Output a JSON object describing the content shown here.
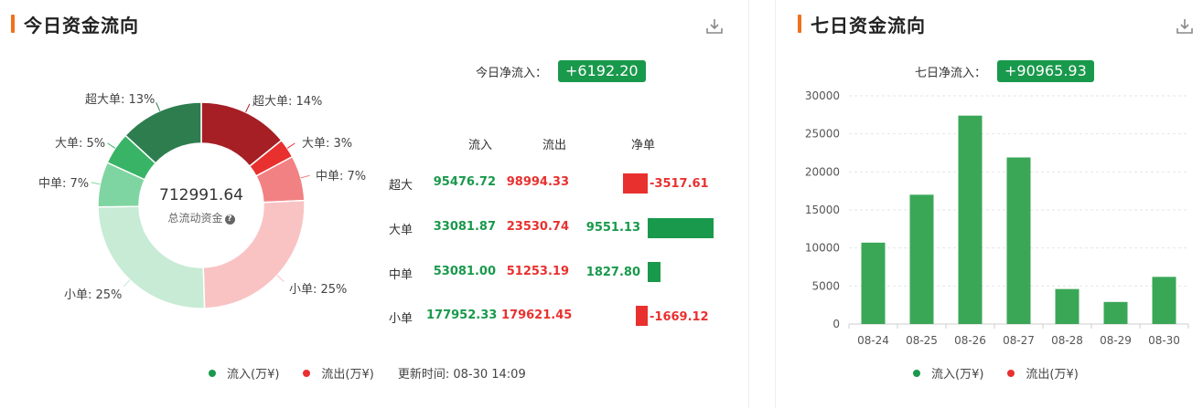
{
  "colors": {
    "accent": "#f0711c",
    "inflow": "#19994c",
    "outflow": "#e8312f",
    "bar_green": "#3aa757"
  },
  "today": {
    "title": "今日资金流向",
    "net_label": "今日净流入：",
    "net_value": "+6192.20",
    "total_value": "712991.64",
    "total_label": "总流动资金",
    "table": {
      "headers": {
        "in": "流入",
        "out": "流出",
        "net": "净单"
      },
      "rows": [
        {
          "label": "超大",
          "in": "95476.72",
          "out": "98994.33",
          "net": "-3517.61",
          "net_value": -3517.61
        },
        {
          "label": "大单",
          "in": "33081.87",
          "out": "23530.74",
          "net": "9551.13",
          "net_value": 9551.13
        },
        {
          "label": "中单",
          "in": "53081.00",
          "out": "51253.19",
          "net": "1827.80",
          "net_value": 1827.8
        },
        {
          "label": "小单",
          "in": "177952.33",
          "out": "179621.45",
          "net": "-1669.12",
          "net_value": -1669.12
        }
      ]
    },
    "legend": {
      "in": "流入(万¥)",
      "out": "流出(万¥)",
      "updated": "更新时间: 08-30 14:09"
    },
    "download_icon": "download-icon",
    "help_icon": "question-icon"
  },
  "seven_day": {
    "title": "七日资金流向",
    "net_label": "七日净流入：",
    "net_value": "+90965.93",
    "legend": {
      "in": "流入(万¥)",
      "out": "流出(万¥)"
    },
    "download_icon": "download-icon"
  },
  "chart_data": [
    {
      "type": "pie",
      "variant": "donut",
      "labels": [
        "超大单: 14%",
        "大单: 3%",
        "中单: 7%",
        "小单: 25%",
        "小单: 25%",
        "中单: 7%",
        "大单: 5%",
        "超大单: 13%"
      ],
      "categories": [
        "超大单",
        "大单",
        "中单",
        "小单",
        "小单",
        "中单",
        "大单",
        "超大单"
      ],
      "values": [
        14,
        3,
        7,
        25,
        25,
        7,
        5,
        13
      ],
      "colors": [
        "#a51f25",
        "#e8312f",
        "#f28184",
        "#f9c3c4",
        "#c7ebd5",
        "#7fd5a1",
        "#39b467",
        "#2e7d4f"
      ],
      "legend": [
        "流入(万¥)",
        "流出(万¥)"
      ]
    },
    {
      "type": "bar",
      "categories": [
        "08-24",
        "08-25",
        "08-26",
        "08-27",
        "08-28",
        "08-29",
        "08-30"
      ],
      "values": [
        10700,
        17000,
        27400,
        21900,
        4600,
        2900,
        6200
      ],
      "ylim": [
        0,
        30000
      ],
      "yticks": [
        0,
        5000,
        10000,
        15000,
        20000,
        25000,
        30000
      ],
      "grid": true,
      "legend": [
        "流入(万¥)",
        "流出(万¥)"
      ],
      "legend_position": "bottom"
    }
  ]
}
